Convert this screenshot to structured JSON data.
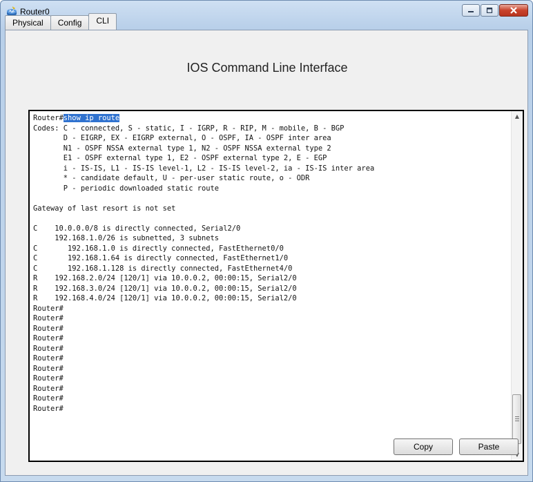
{
  "window": {
    "title": "Router0",
    "controls": [
      "minimize",
      "maximize",
      "close"
    ]
  },
  "tabs": [
    {
      "label": "Physical",
      "active": false
    },
    {
      "label": "Config",
      "active": false
    },
    {
      "label": "CLI",
      "active": true
    }
  ],
  "cli": {
    "heading": "IOS Command Line Interface",
    "prompt": "Router#",
    "command": "show ip route",
    "lines": [
      "Codes: C - connected, S - static, I - IGRP, R - RIP, M - mobile, B - BGP",
      "       D - EIGRP, EX - EIGRP external, O - OSPF, IA - OSPF inter area",
      "       N1 - OSPF NSSA external type 1, N2 - OSPF NSSA external type 2",
      "       E1 - OSPF external type 1, E2 - OSPF external type 2, E - EGP",
      "       i - IS-IS, L1 - IS-IS level-1, L2 - IS-IS level-2, ia - IS-IS inter area",
      "       * - candidate default, U - per-user static route, o - ODR",
      "       P - periodic downloaded static route",
      "",
      "Gateway of last resort is not set",
      "",
      "C    10.0.0.0/8 is directly connected, Serial2/0",
      "     192.168.1.0/26 is subnetted, 3 subnets",
      "C       192.168.1.0 is directly connected, FastEthernet0/0",
      "C       192.168.1.64 is directly connected, FastEthernet1/0",
      "C       192.168.1.128 is directly connected, FastEthernet4/0",
      "R    192.168.2.0/24 [120/1] via 10.0.0.2, 00:00:15, Serial2/0",
      "R    192.168.3.0/24 [120/1] via 10.0.0.2, 00:00:15, Serial2/0",
      "R    192.168.4.0/24 [120/1] via 10.0.0.2, 00:00:15, Serial2/0",
      "Router#",
      "Router#",
      "Router#",
      "Router#",
      "Router#",
      "Router#",
      "Router#",
      "Router#",
      "Router#",
      "Router#",
      "Router#"
    ]
  },
  "buttons": {
    "copy": "Copy",
    "paste": "Paste"
  },
  "icons": {
    "app": "router-icon",
    "minimize": "minimize-icon",
    "maximize": "maximize-icon",
    "close": "close-icon"
  }
}
